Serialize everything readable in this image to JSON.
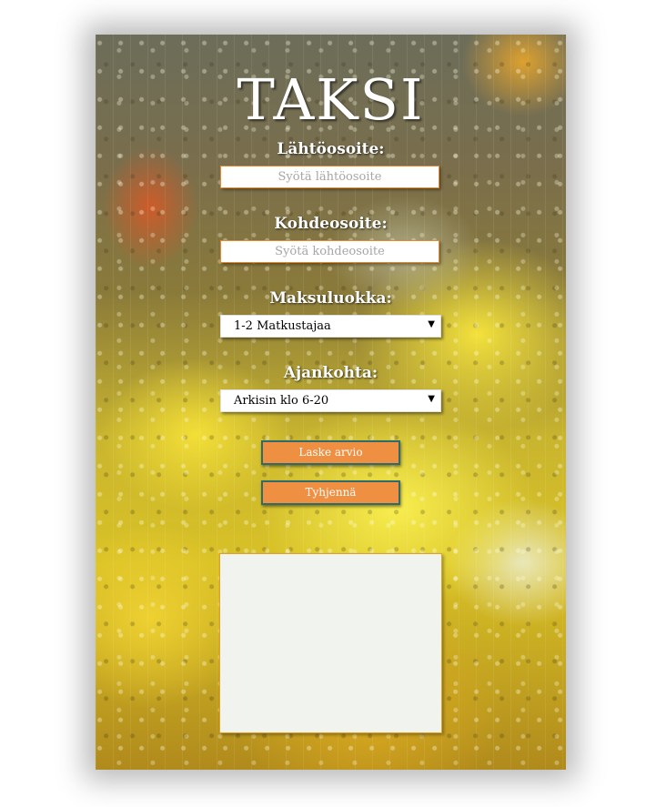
{
  "title": "TAKSI",
  "form": {
    "start_label": "Lähtöosoite:",
    "start_placeholder": "Syötä lähtöosoite",
    "dest_label": "Kohdeosoite:",
    "dest_placeholder": "Syötä kohdeosoite",
    "payment_label": "Maksuluokka:",
    "payment_value": "1-2 Matkustajaa",
    "time_label": "Ajankohta:",
    "time_value": "Arkisin klo 6-20",
    "calculate_label": "Laske arvio",
    "clear_label": "Tyhjennä"
  },
  "result": {
    "text": ""
  },
  "colors": {
    "accent": "#ef8f42",
    "button_border": "#2f6b6b",
    "input_border": "#e8892c",
    "result_background": "#f1f3ef"
  }
}
